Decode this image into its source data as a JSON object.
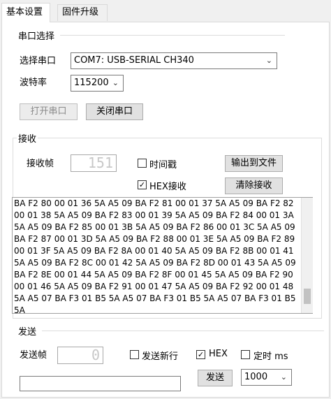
{
  "tabs": [
    {
      "label": "基本设置",
      "active": true
    },
    {
      "label": "固件升级",
      "active": false
    }
  ],
  "serial": {
    "group_title": "串口选择",
    "port_label": "选择串口",
    "port_value": "COM7: USB-SERIAL CH340",
    "baud_label": "波特率",
    "baud_value": "115200",
    "open_button": "打开串口",
    "close_button": "关闭串口"
  },
  "receive": {
    "group_title": "接收",
    "frame_label": "接收帧",
    "frame_count": "151",
    "timestamp_label": "时间戳",
    "timestamp_checked": false,
    "hex_label": "HEX接收",
    "hex_checked": true,
    "export_button": "输出到文件",
    "clear_button": "清除接收",
    "log_lines": [
      "BA F2 80 00 01 36 5A A5 09 BA F2 81 00 01 37 5A A5 09 BA F2 82",
      "00 01 38 5A A5 09 BA F2 83 00 01 39 5A A5 09 BA F2 84 00 01 3A",
      "5A A5 09 BA F2 85 00 01 3B 5A A5 09 BA F2 86 00 01 3C 5A A5 09",
      "BA F2 87 00 01 3D 5A A5 09 BA F2 88 00 01 3E 5A A5 09 BA F2 89",
      "00 01 3F 5A A5 09 BA F2 8A 00 01 40 5A A5 09 BA F2 8B 00 01 41",
      "5A A5 09 BA F2 8C 00 01 42 5A A5 09 BA F2 8D 00 01 43 5A A5 09",
      "BA F2 8E 00 01 44 5A A5 09 BA F2 8F 00 01 45 5A A5 09 BA F2 90",
      "00 01 46 5A A5 09 BA F2 91 00 01 47 5A A5 09 BA F2 92 00 01 48",
      "5A A5 07 BA F3 01 B5 5A A5 07 BA F3 01 B5 5A A5 07 BA F3 01 B5",
      "5A"
    ]
  },
  "send": {
    "group_title": "发送",
    "frame_label": "发送帧",
    "frame_count": "0",
    "newline_label": "发送新行",
    "newline_checked": false,
    "hex_label": "HEX",
    "hex_checked": true,
    "timer_label": "定时 ms",
    "timer_checked": false,
    "input_value": "",
    "send_button": "发送",
    "interval_value": "1000"
  },
  "icons": {
    "dropdown": "chevron-down-icon",
    "check": "checkmark-icon"
  }
}
